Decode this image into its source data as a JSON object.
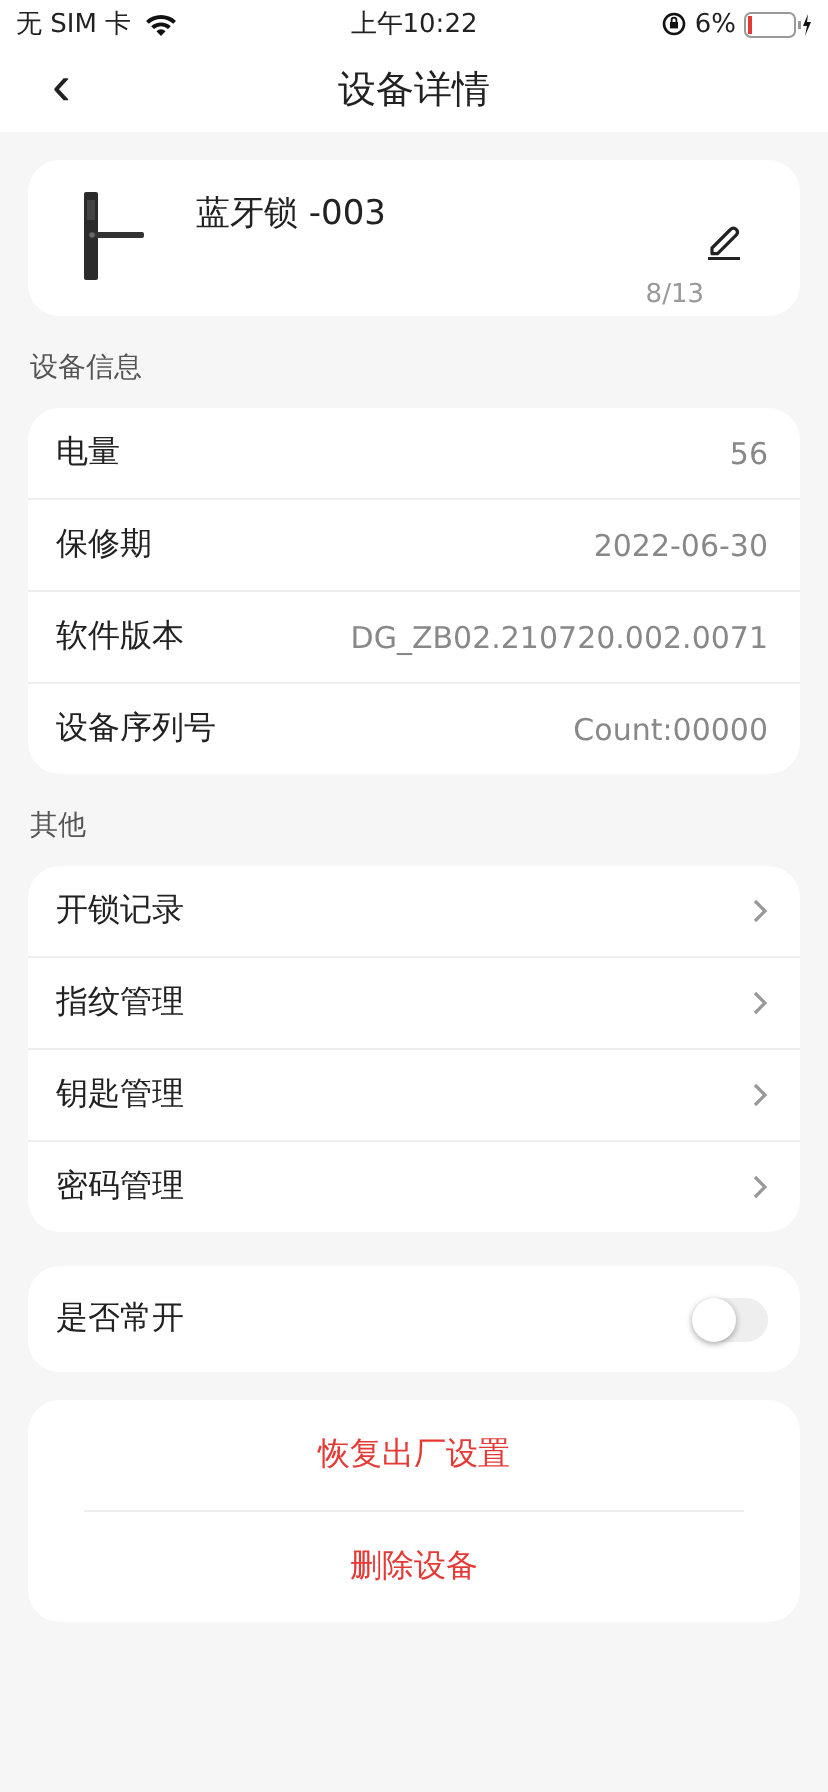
{
  "status_bar": {
    "carrier": "无 SIM 卡",
    "time": "上午10:22",
    "battery": "6%"
  },
  "nav": {
    "back": "‹",
    "title": "设备详情"
  },
  "device": {
    "name": "蓝牙锁 -003",
    "count": "8/13"
  },
  "info": {
    "heading": "设备信息",
    "rows": [
      {
        "label": "电量",
        "value": "56"
      },
      {
        "label": "保修期",
        "value": "2022-06-30"
      },
      {
        "label": "软件版本",
        "value": "DG_ZB02.210720.002.0071"
      },
      {
        "label": "设备序列号",
        "value": "Count:00000"
      }
    ]
  },
  "other": {
    "heading": "其他",
    "items": [
      {
        "label": "开锁记录"
      },
      {
        "label": "指纹管理"
      },
      {
        "label": "钥匙管理"
      },
      {
        "label": "密码管理"
      }
    ]
  },
  "always_open": {
    "label": "是否常开",
    "on": false
  },
  "actions": [
    "恢复出厂设置",
    "删除设备"
  ]
}
